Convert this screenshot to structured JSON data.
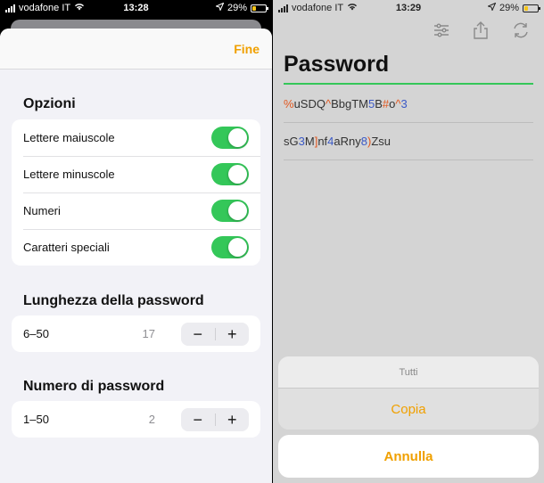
{
  "left": {
    "status": {
      "carrier": "vodafone IT",
      "time": "13:28",
      "battery": "29%"
    },
    "header": {
      "done_label": "Fine"
    },
    "options": {
      "title": "Opzioni",
      "items": [
        {
          "label": "Lettere maiuscole",
          "enabled": true
        },
        {
          "label": "Lettere minuscole",
          "enabled": true
        },
        {
          "label": "Numeri",
          "enabled": true
        },
        {
          "label": "Caratteri speciali",
          "enabled": true
        }
      ]
    },
    "length": {
      "title": "Lunghezza della password",
      "range": "6–50",
      "value": "17",
      "minus": "−",
      "plus": "+"
    },
    "count": {
      "title": "Numero di password",
      "range": "1–50",
      "value": "2",
      "minus": "−",
      "plus": "+"
    }
  },
  "right": {
    "status": {
      "carrier": "vodafone IT",
      "time": "13:29",
      "battery": "29%"
    },
    "toolbar": {
      "icons": [
        "sliders-icon",
        "share-icon",
        "refresh-icon"
      ]
    },
    "title": "Password",
    "passwords": [
      [
        {
          "t": "%",
          "k": "sym"
        },
        {
          "t": "uSDQ",
          "k": "let"
        },
        {
          "t": "^",
          "k": "sym"
        },
        {
          "t": "BbgTM",
          "k": "let"
        },
        {
          "t": "5",
          "k": "num"
        },
        {
          "t": "B",
          "k": "let"
        },
        {
          "t": "#",
          "k": "sym"
        },
        {
          "t": "o",
          "k": "let"
        },
        {
          "t": "^",
          "k": "sym"
        },
        {
          "t": "3",
          "k": "num"
        }
      ],
      [
        {
          "t": "s",
          "k": "let"
        },
        {
          "t": "G",
          "k": "let"
        },
        {
          "t": "3",
          "k": "num"
        },
        {
          "t": "M",
          "k": "let"
        },
        {
          "t": "]",
          "k": "sym"
        },
        {
          "t": "nf",
          "k": "let"
        },
        {
          "t": "4",
          "k": "num"
        },
        {
          "t": "aRny",
          "k": "let"
        },
        {
          "t": "8",
          "k": "num"
        },
        {
          "t": ")",
          "k": "sym"
        },
        {
          "t": "Zsu",
          "k": "let"
        }
      ]
    ],
    "action_sheet": {
      "title": "Tutti",
      "action": "Copia",
      "cancel": "Annulla"
    }
  },
  "colors": {
    "accent": "#f0a000",
    "toggle_on": "#34c759",
    "symbol": "#e2571e",
    "number": "#3b59c6"
  }
}
